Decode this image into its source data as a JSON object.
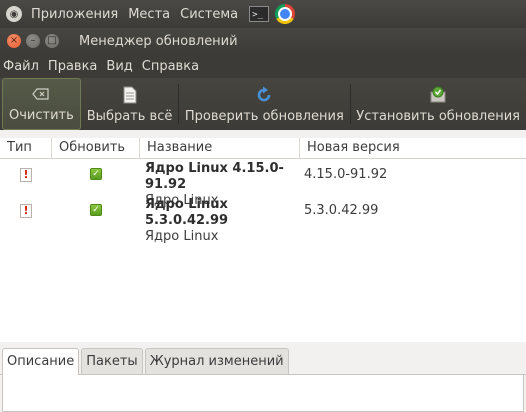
{
  "system_panel": {
    "menus": [
      "Приложения",
      "Места",
      "Система"
    ],
    "terminal_glyph": ">_"
  },
  "window": {
    "title": "Менеджер обновлений",
    "close_glyph": "×",
    "min_glyph": "–",
    "max_glyph": "□"
  },
  "menubar": {
    "items": [
      "Файл",
      "Правка",
      "Вид",
      "Справка"
    ]
  },
  "toolbar": {
    "clear_label": "Очистить",
    "select_all_label": "Выбрать всё",
    "check_label": "Проверить обновления",
    "install_label": "Установить обновления"
  },
  "table": {
    "headers": [
      "Тип",
      "Обновить",
      "Название",
      "Новая версия"
    ],
    "rows": [
      {
        "type_glyph": "!",
        "update_glyph": "✓",
        "name": "Ядро Linux 4.15.0-91.92",
        "description": "Ядро Linux",
        "new_version": "4.15.0-91.92"
      },
      {
        "type_glyph": "!",
        "update_glyph": "✓",
        "name": "Ядро Linux 5.3.0.42.99",
        "description": "Ядро Linux",
        "new_version": "5.3.0.42.99"
      }
    ]
  },
  "tabs": {
    "items": [
      "Описание",
      "Пакеты",
      "Журнал изменений"
    ],
    "selected": 0
  },
  "icons": {
    "clear": "clear-icon",
    "select_all": "document-icon",
    "check": "refresh-icon",
    "install": "install-icon"
  },
  "colors": {
    "panel_bg": "#3c3b37",
    "close_button": "#e65a2c",
    "checkbox_green": "#6aac27",
    "warning_red": "#d8240a"
  }
}
